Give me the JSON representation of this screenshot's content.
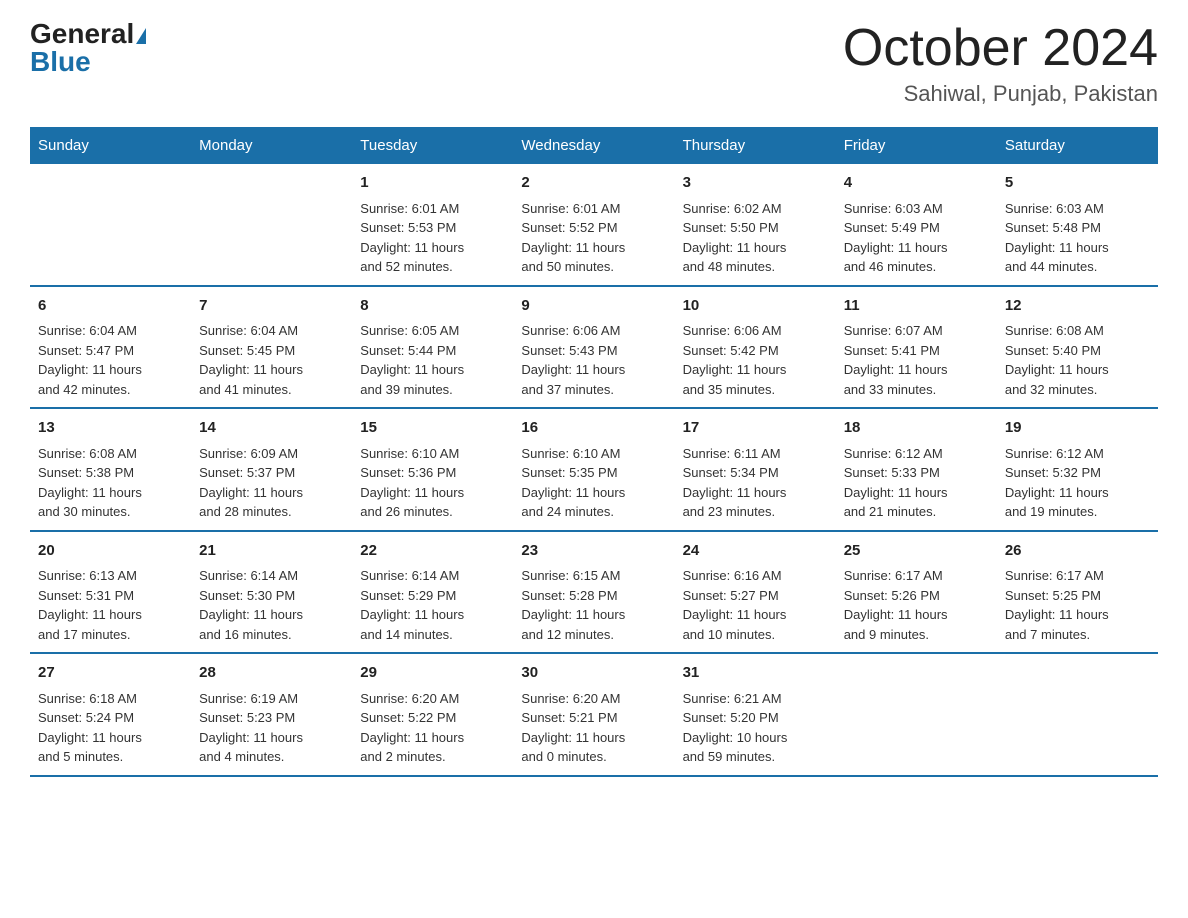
{
  "header": {
    "logo_general": "General",
    "logo_blue": "Blue",
    "title": "October 2024",
    "subtitle": "Sahiwal, Punjab, Pakistan"
  },
  "days_of_week": [
    "Sunday",
    "Monday",
    "Tuesday",
    "Wednesday",
    "Thursday",
    "Friday",
    "Saturday"
  ],
  "weeks": [
    [
      {
        "day": "",
        "info": ""
      },
      {
        "day": "",
        "info": ""
      },
      {
        "day": "1",
        "info": "Sunrise: 6:01 AM\nSunset: 5:53 PM\nDaylight: 11 hours\nand 52 minutes."
      },
      {
        "day": "2",
        "info": "Sunrise: 6:01 AM\nSunset: 5:52 PM\nDaylight: 11 hours\nand 50 minutes."
      },
      {
        "day": "3",
        "info": "Sunrise: 6:02 AM\nSunset: 5:50 PM\nDaylight: 11 hours\nand 48 minutes."
      },
      {
        "day": "4",
        "info": "Sunrise: 6:03 AM\nSunset: 5:49 PM\nDaylight: 11 hours\nand 46 minutes."
      },
      {
        "day": "5",
        "info": "Sunrise: 6:03 AM\nSunset: 5:48 PM\nDaylight: 11 hours\nand 44 minutes."
      }
    ],
    [
      {
        "day": "6",
        "info": "Sunrise: 6:04 AM\nSunset: 5:47 PM\nDaylight: 11 hours\nand 42 minutes."
      },
      {
        "day": "7",
        "info": "Sunrise: 6:04 AM\nSunset: 5:45 PM\nDaylight: 11 hours\nand 41 minutes."
      },
      {
        "day": "8",
        "info": "Sunrise: 6:05 AM\nSunset: 5:44 PM\nDaylight: 11 hours\nand 39 minutes."
      },
      {
        "day": "9",
        "info": "Sunrise: 6:06 AM\nSunset: 5:43 PM\nDaylight: 11 hours\nand 37 minutes."
      },
      {
        "day": "10",
        "info": "Sunrise: 6:06 AM\nSunset: 5:42 PM\nDaylight: 11 hours\nand 35 minutes."
      },
      {
        "day": "11",
        "info": "Sunrise: 6:07 AM\nSunset: 5:41 PM\nDaylight: 11 hours\nand 33 minutes."
      },
      {
        "day": "12",
        "info": "Sunrise: 6:08 AM\nSunset: 5:40 PM\nDaylight: 11 hours\nand 32 minutes."
      }
    ],
    [
      {
        "day": "13",
        "info": "Sunrise: 6:08 AM\nSunset: 5:38 PM\nDaylight: 11 hours\nand 30 minutes."
      },
      {
        "day": "14",
        "info": "Sunrise: 6:09 AM\nSunset: 5:37 PM\nDaylight: 11 hours\nand 28 minutes."
      },
      {
        "day": "15",
        "info": "Sunrise: 6:10 AM\nSunset: 5:36 PM\nDaylight: 11 hours\nand 26 minutes."
      },
      {
        "day": "16",
        "info": "Sunrise: 6:10 AM\nSunset: 5:35 PM\nDaylight: 11 hours\nand 24 minutes."
      },
      {
        "day": "17",
        "info": "Sunrise: 6:11 AM\nSunset: 5:34 PM\nDaylight: 11 hours\nand 23 minutes."
      },
      {
        "day": "18",
        "info": "Sunrise: 6:12 AM\nSunset: 5:33 PM\nDaylight: 11 hours\nand 21 minutes."
      },
      {
        "day": "19",
        "info": "Sunrise: 6:12 AM\nSunset: 5:32 PM\nDaylight: 11 hours\nand 19 minutes."
      }
    ],
    [
      {
        "day": "20",
        "info": "Sunrise: 6:13 AM\nSunset: 5:31 PM\nDaylight: 11 hours\nand 17 minutes."
      },
      {
        "day": "21",
        "info": "Sunrise: 6:14 AM\nSunset: 5:30 PM\nDaylight: 11 hours\nand 16 minutes."
      },
      {
        "day": "22",
        "info": "Sunrise: 6:14 AM\nSunset: 5:29 PM\nDaylight: 11 hours\nand 14 minutes."
      },
      {
        "day": "23",
        "info": "Sunrise: 6:15 AM\nSunset: 5:28 PM\nDaylight: 11 hours\nand 12 minutes."
      },
      {
        "day": "24",
        "info": "Sunrise: 6:16 AM\nSunset: 5:27 PM\nDaylight: 11 hours\nand 10 minutes."
      },
      {
        "day": "25",
        "info": "Sunrise: 6:17 AM\nSunset: 5:26 PM\nDaylight: 11 hours\nand 9 minutes."
      },
      {
        "day": "26",
        "info": "Sunrise: 6:17 AM\nSunset: 5:25 PM\nDaylight: 11 hours\nand 7 minutes."
      }
    ],
    [
      {
        "day": "27",
        "info": "Sunrise: 6:18 AM\nSunset: 5:24 PM\nDaylight: 11 hours\nand 5 minutes."
      },
      {
        "day": "28",
        "info": "Sunrise: 6:19 AM\nSunset: 5:23 PM\nDaylight: 11 hours\nand 4 minutes."
      },
      {
        "day": "29",
        "info": "Sunrise: 6:20 AM\nSunset: 5:22 PM\nDaylight: 11 hours\nand 2 minutes."
      },
      {
        "day": "30",
        "info": "Sunrise: 6:20 AM\nSunset: 5:21 PM\nDaylight: 11 hours\nand 0 minutes."
      },
      {
        "day": "31",
        "info": "Sunrise: 6:21 AM\nSunset: 5:20 PM\nDaylight: 10 hours\nand 59 minutes."
      },
      {
        "day": "",
        "info": ""
      },
      {
        "day": "",
        "info": ""
      }
    ]
  ]
}
